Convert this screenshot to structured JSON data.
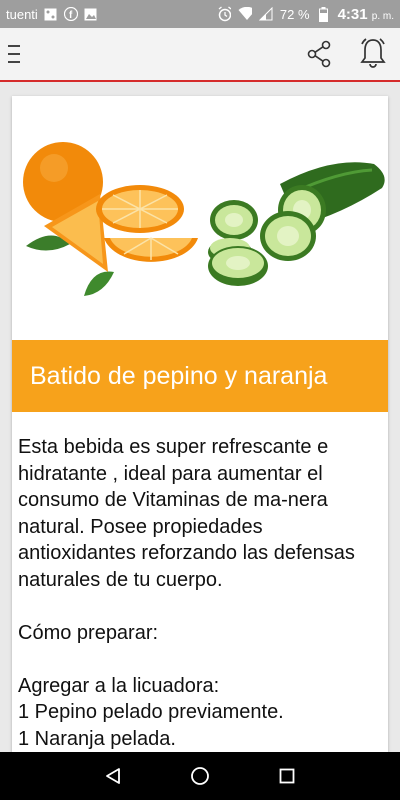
{
  "status_bar": {
    "carrier": "tuenti",
    "battery": "72 %",
    "time": "4:31",
    "ampm": "p. m.",
    "icons": [
      "notification-square-icon",
      "facebook-icon",
      "image-icon",
      "alarm-icon",
      "wifi-icon",
      "signal-icon",
      "battery-icon"
    ]
  },
  "app_bar": {
    "icons": [
      "menu-icon",
      "share-icon",
      "bell-icon"
    ],
    "accent_color": "#d52b2b"
  },
  "article": {
    "title": "Batido de pepino y naranja",
    "title_bg_color": "#f7a21b",
    "image": "orange-and-cucumber-image",
    "paragraphs": [
      "Esta bebida es super refrescante e hidratante , ideal para aumentar el consumo de Vitaminas de ma-nera natural. Posee propiedades antioxidantes reforzando las defensas naturales de tu cuerpo.",
      "Cómo preparar:"
    ],
    "ingredients_heading": "Agregar a la licuadora:",
    "ingredients": [
      "1 Pepino pelado previamente.",
      "1 Naranja pelada."
    ]
  },
  "nav_bar": {
    "icons": [
      "back-icon",
      "home-icon",
      "recents-icon"
    ]
  }
}
